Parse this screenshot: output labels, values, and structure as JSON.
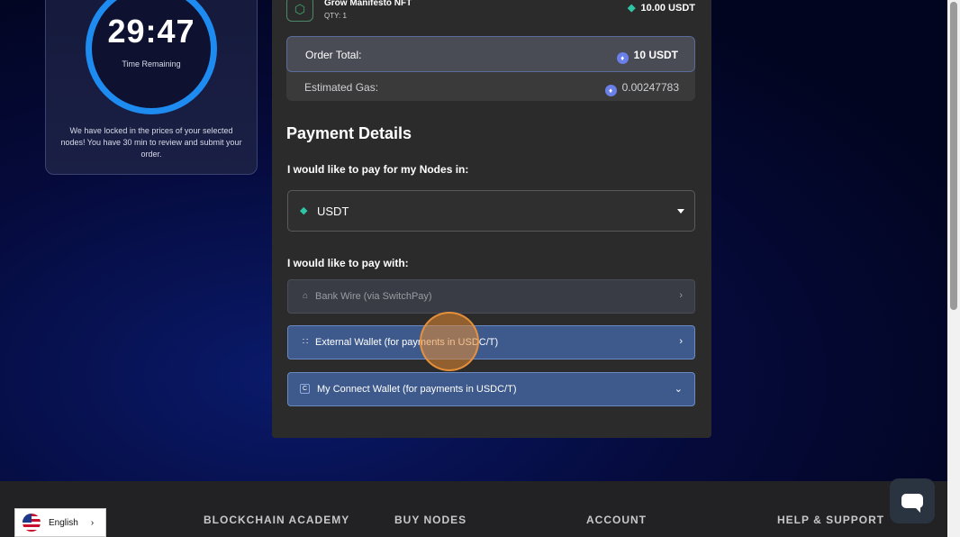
{
  "timer": {
    "value": "29:47",
    "label": "Time Remaining",
    "note": "We have locked in the prices of your selected nodes! You have 30 min to review and submit your order."
  },
  "order": {
    "product_name": "Grow Manifesto NFT",
    "product_qty": "QTY: 1",
    "product_price": "10.00 USDT",
    "total_label": "Order Total:",
    "total_value": "10 USDT",
    "gas_label": "Estimated Gas:",
    "gas_value": "0.00247783"
  },
  "payment": {
    "title": "Payment Details",
    "currency_label": "I would like to pay for my Nodes in:",
    "currency_selected": "USDT",
    "method_label": "I would like to pay with:",
    "options": [
      {
        "label": "Bank Wire (via SwitchPay)",
        "icon": "bank-icon",
        "chevron": "chevron-right-icon"
      },
      {
        "label": "External Wallet (for payments in USDC/T)",
        "icon": "qr-icon",
        "chevron": "chevron-right-icon"
      },
      {
        "label": "My Connect Wallet (for payments in USDC/T)",
        "icon": "wallet-icon",
        "chevron": "chevron-down-icon"
      }
    ]
  },
  "footer": {
    "links": [
      "BLOCKCHAIN ACADEMY",
      "BUY NODES",
      "ACCOUNT",
      "HELP & SUPPORT"
    ]
  },
  "language": {
    "selected": "English"
  },
  "colors": {
    "accent_blue": "#1e8bf0",
    "option_selected": "#3e5a8c",
    "tether_green": "#2ec7a6"
  }
}
